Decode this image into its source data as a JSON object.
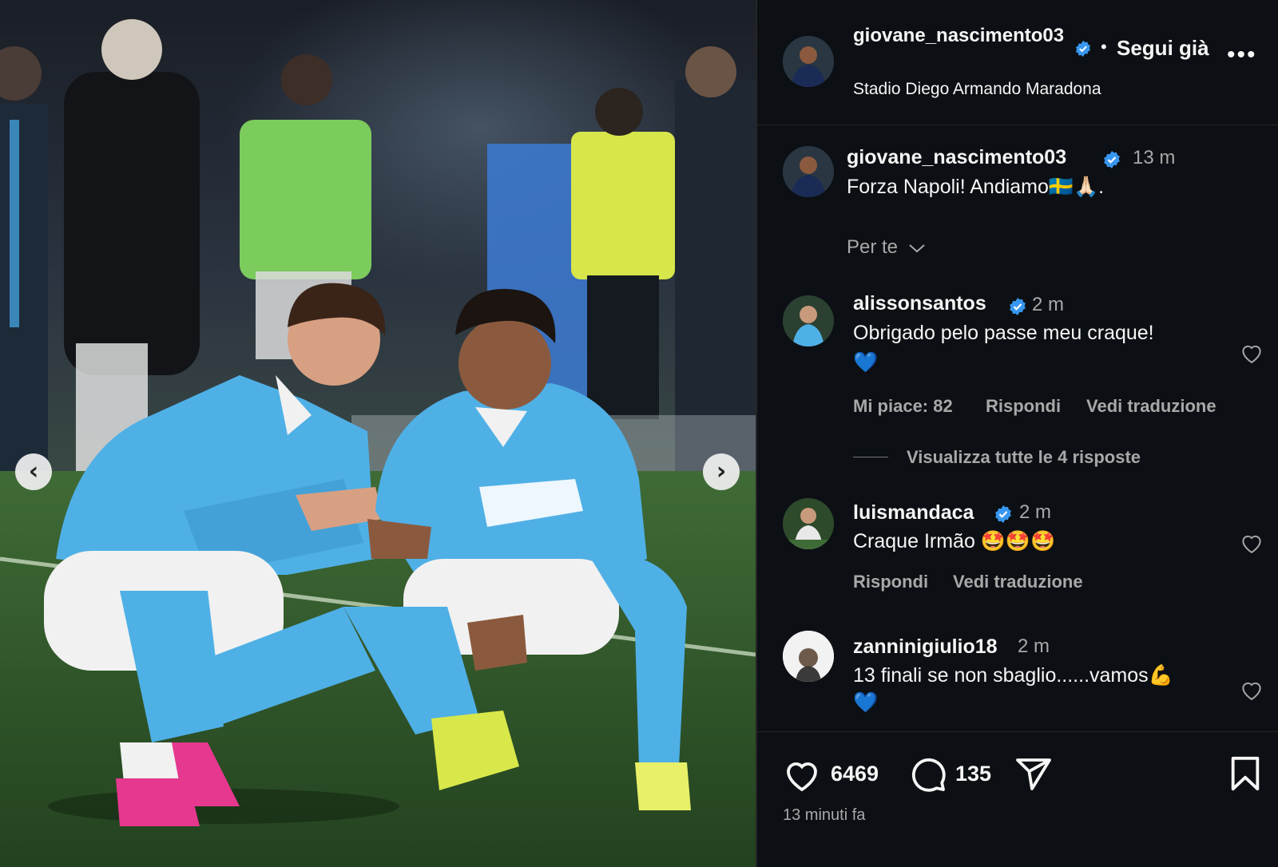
{
  "post": {
    "author": "giovane_nascimento03",
    "location": "Stadio Diego Armando Maradona",
    "follow_label": "Segui già",
    "more_label": "•••",
    "separator": "•",
    "caption": "Forza Napoli! Andiamo🇸🇪🙏🏻.",
    "caption_time": "13 m",
    "sort_label": "Per te",
    "posted_ago": "13 minuti fa"
  },
  "comments": [
    {
      "user": "alissonsantos",
      "verified": true,
      "time": "2 m",
      "text": "Obrigado pelo passe meu craque!",
      "text2": "💙",
      "likes_label": "Mi piace: 82",
      "reply_label": "Rispondi",
      "translate_label": "Vedi traduzione",
      "view_replies": "Visualizza tutte le 4 risposte"
    },
    {
      "user": "luismandaca",
      "verified": true,
      "time": "2 m",
      "text": "Craque Irmão 🤩🤩🤩",
      "reply_label": "Rispondi",
      "translate_label": "Vedi traduzione"
    },
    {
      "user": "zanninigiulio18",
      "verified": false,
      "time": "2 m",
      "text": "13 finali se non sbaglio......vamos💪",
      "text2": "💙"
    }
  ],
  "actions": {
    "likes": "6469",
    "comments": "135"
  },
  "carousel": {
    "prev": "‹",
    "next": "›"
  },
  "colors": {
    "background": "#0c1014",
    "verified": "#3897f0",
    "secondary_text": "#a8a8a8",
    "jersey": "#4fb0e6"
  },
  "icons": [
    "chevron-left-icon",
    "chevron-right-icon",
    "verified-badge-icon",
    "more-icon",
    "chevron-down-icon",
    "heart-icon",
    "comment-icon",
    "share-icon",
    "bookmark-icon"
  ]
}
